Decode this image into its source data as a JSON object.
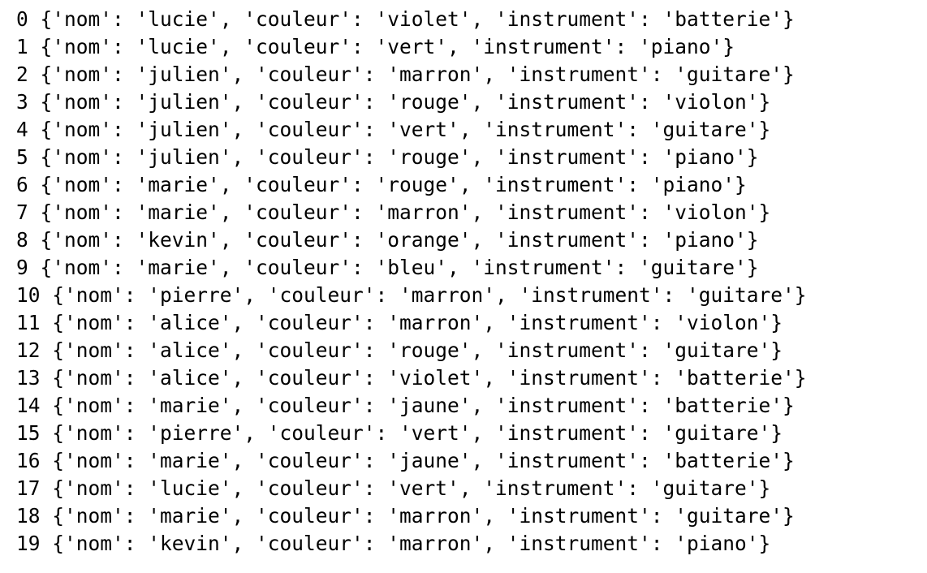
{
  "output": {
    "lines": [
      "0 {'nom': 'lucie', 'couleur': 'violet', 'instrument': 'batterie'}",
      "1 {'nom': 'lucie', 'couleur': 'vert', 'instrument': 'piano'}",
      "2 {'nom': 'julien', 'couleur': 'marron', 'instrument': 'guitare'}",
      "3 {'nom': 'julien', 'couleur': 'rouge', 'instrument': 'violon'}",
      "4 {'nom': 'julien', 'couleur': 'vert', 'instrument': 'guitare'}",
      "5 {'nom': 'julien', 'couleur': 'rouge', 'instrument': 'piano'}",
      "6 {'nom': 'marie', 'couleur': 'rouge', 'instrument': 'piano'}",
      "7 {'nom': 'marie', 'couleur': 'marron', 'instrument': 'violon'}",
      "8 {'nom': 'kevin', 'couleur': 'orange', 'instrument': 'piano'}",
      "9 {'nom': 'marie', 'couleur': 'bleu', 'instrument': 'guitare'}",
      "10 {'nom': 'pierre', 'couleur': 'marron', 'instrument': 'guitare'}",
      "11 {'nom': 'alice', 'couleur': 'marron', 'instrument': 'violon'}",
      "12 {'nom': 'alice', 'couleur': 'rouge', 'instrument': 'guitare'}",
      "13 {'nom': 'alice', 'couleur': 'violet', 'instrument': 'batterie'}",
      "14 {'nom': 'marie', 'couleur': 'jaune', 'instrument': 'batterie'}",
      "15 {'nom': 'pierre', 'couleur': 'vert', 'instrument': 'guitare'}",
      "16 {'nom': 'marie', 'couleur': 'jaune', 'instrument': 'batterie'}",
      "17 {'nom': 'lucie', 'couleur': 'vert', 'instrument': 'guitare'}",
      "18 {'nom': 'marie', 'couleur': 'marron', 'instrument': 'guitare'}",
      "19 {'nom': 'kevin', 'couleur': 'marron', 'instrument': 'piano'}"
    ]
  }
}
